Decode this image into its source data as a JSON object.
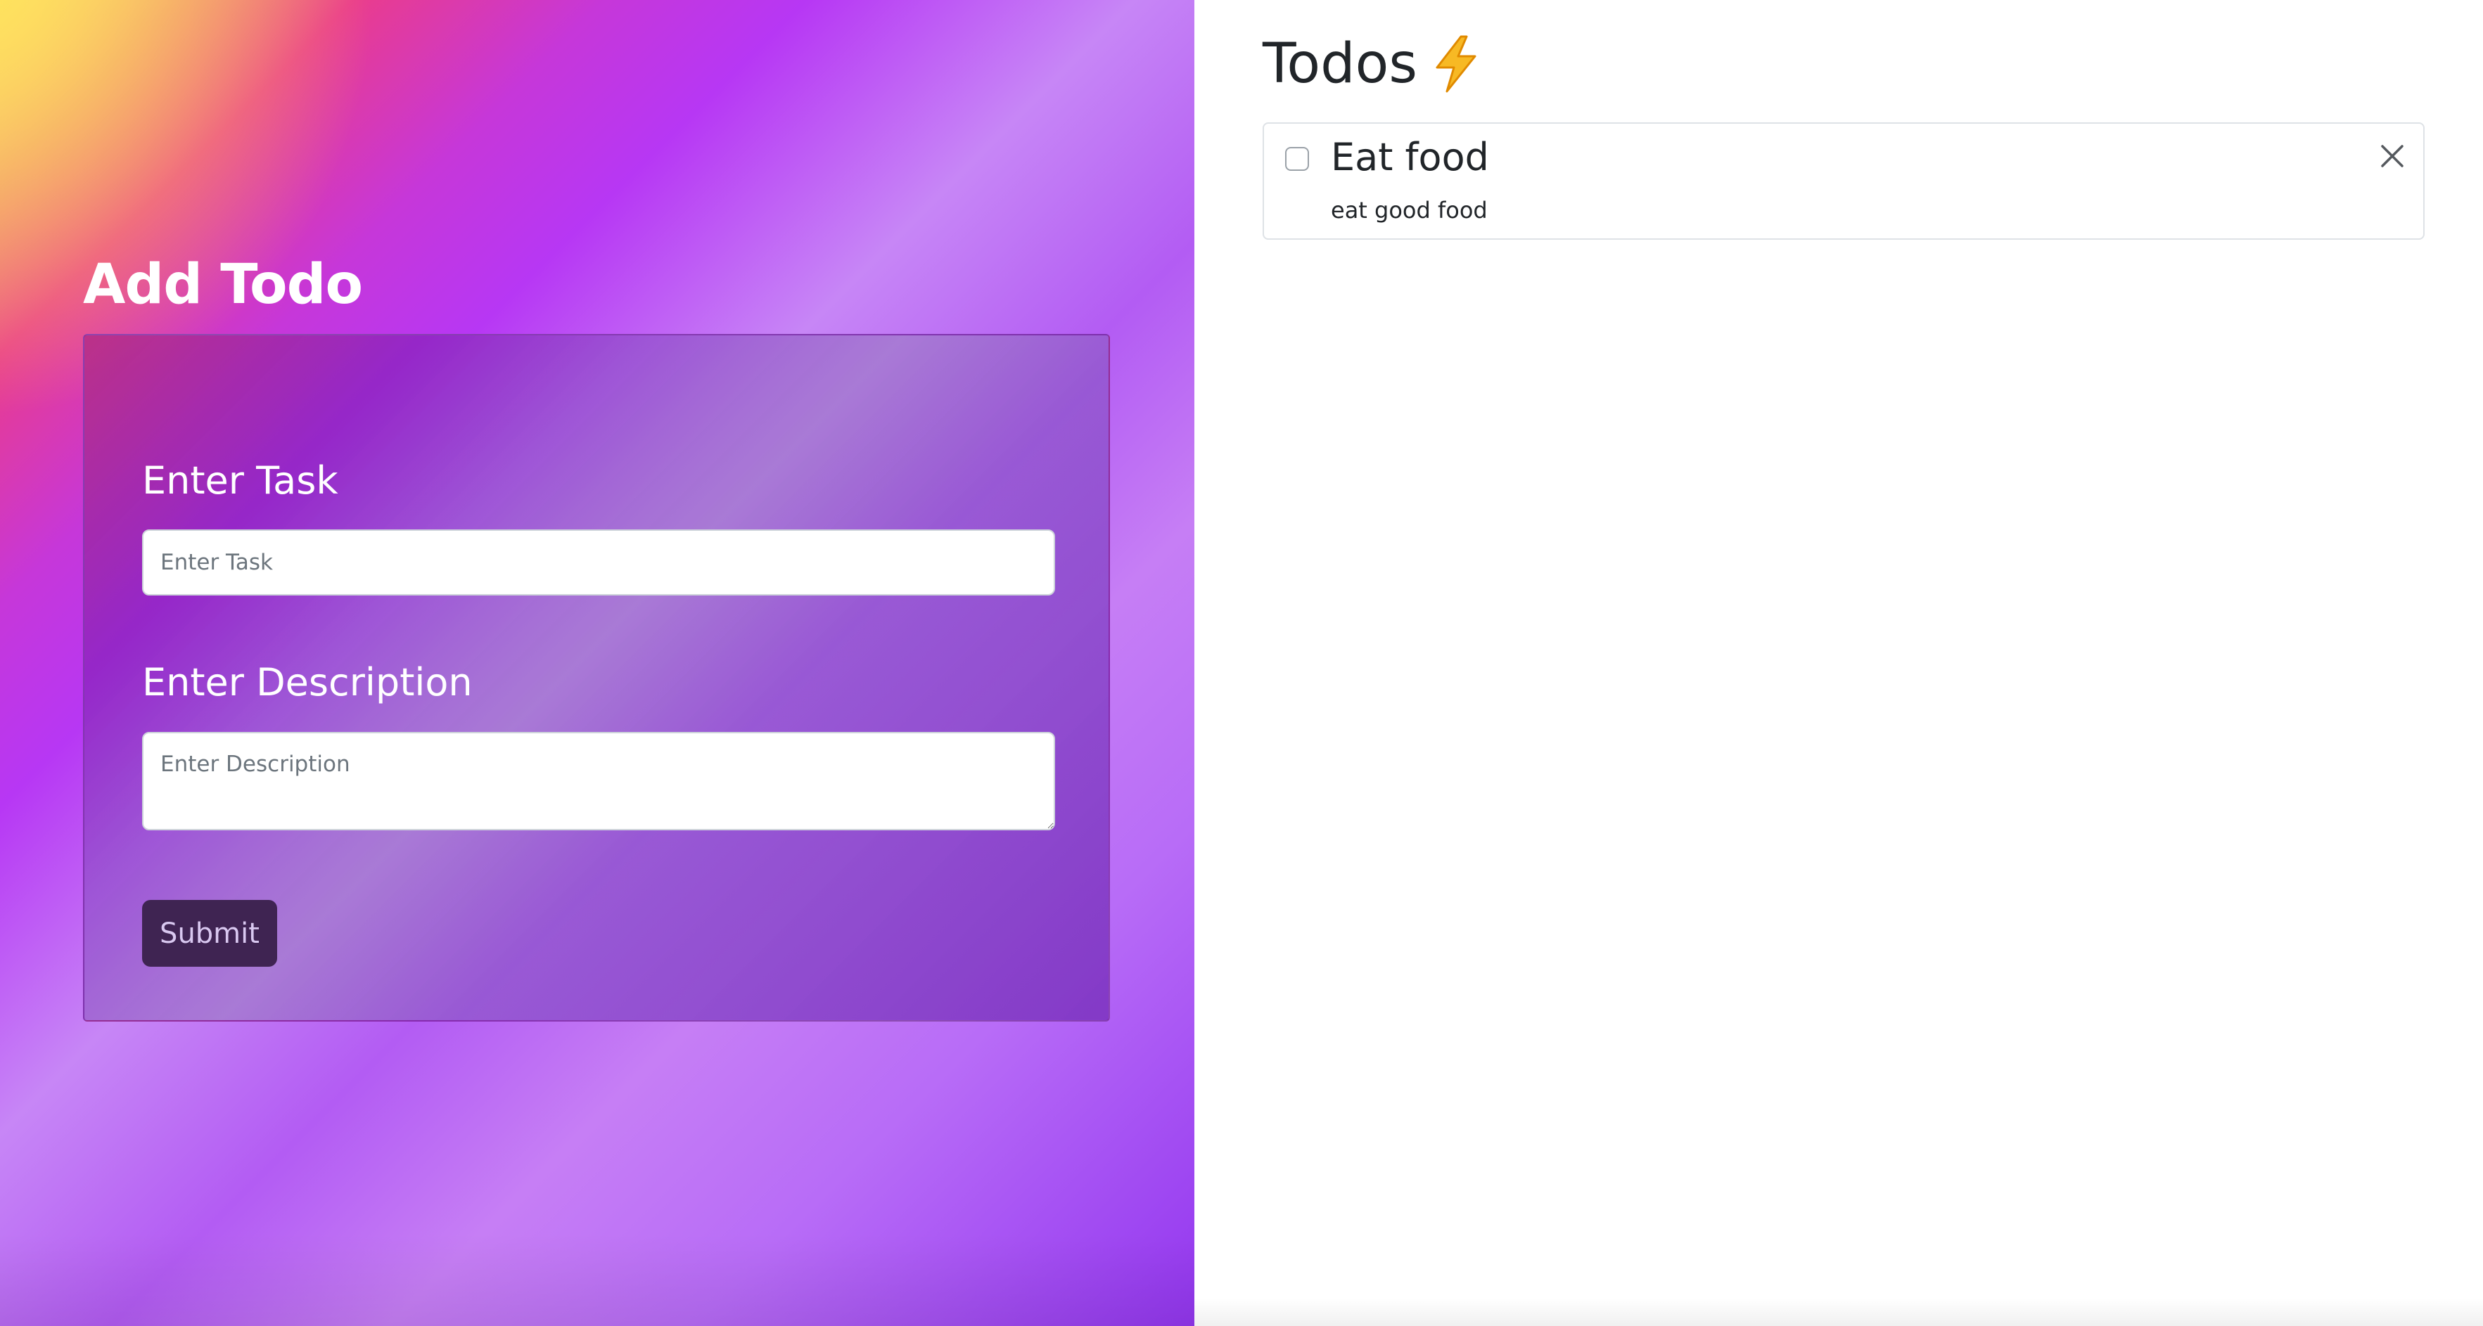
{
  "add_form": {
    "heading": "Add Todo",
    "task_label": "Enter Task",
    "task_placeholder": "Enter Task",
    "task_value": "",
    "description_label": "Enter Description",
    "description_placeholder": "Enter Description",
    "description_value": "",
    "submit_label": "Submit"
  },
  "todo_list": {
    "heading": "Todos",
    "heading_icon": "lightning-bolt-icon",
    "items": [
      {
        "title": "Eat food",
        "description": "eat good food",
        "completed": false,
        "delete_icon": "close-icon"
      }
    ]
  },
  "colors": {
    "bolt": "#f7b924",
    "submit_button": "#3f2452",
    "text_dark": "#212529",
    "gradient_start": "#fde16a",
    "gradient_mid": "#b737f4",
    "gradient_end": "#9336ef"
  }
}
